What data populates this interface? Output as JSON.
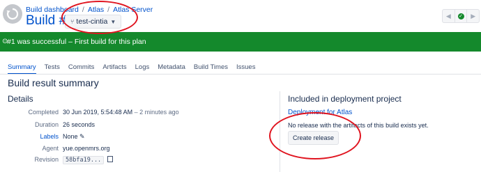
{
  "header": {
    "breadcrumb": [
      "Build dashboard",
      "Atlas",
      "Atlas Server"
    ],
    "breadcrumb_separator": "/",
    "title": "Build #1",
    "branch": "test-cintia",
    "branch_icon": "branch-icon",
    "nav": {
      "prev": "◀",
      "status": "✓",
      "next": "▶"
    }
  },
  "status_bar": {
    "icon": "check-circle-icon",
    "text": "#1 was successful – First build for this plan",
    "color": "#14892c"
  },
  "tabs": [
    "Summary",
    "Tests",
    "Commits",
    "Artifacts",
    "Logs",
    "Metadata",
    "Build Times",
    "Issues"
  ],
  "active_tab": "Summary",
  "summary_title": "Build result summary",
  "details": {
    "title": "Details",
    "completed_label": "Completed",
    "completed_value": "30 Jun 2019, 5:54:48 AM",
    "completed_relative": "– 2 minutes ago",
    "duration_label": "Duration",
    "duration_value": "26 seconds",
    "labels_label": "Labels",
    "labels_value": "None",
    "agent_label": "Agent",
    "agent_value": "yue.openmrs.org",
    "revision_label": "Revision",
    "revision_value": "58bfa19..."
  },
  "deployment": {
    "title": "Included in deployment project",
    "link": "Deployment for Atlas",
    "note": "No release with the artifacts of this build exists yet.",
    "button": "Create release"
  },
  "accent_color": "#0052cc",
  "annotation_color": "#e0141f"
}
